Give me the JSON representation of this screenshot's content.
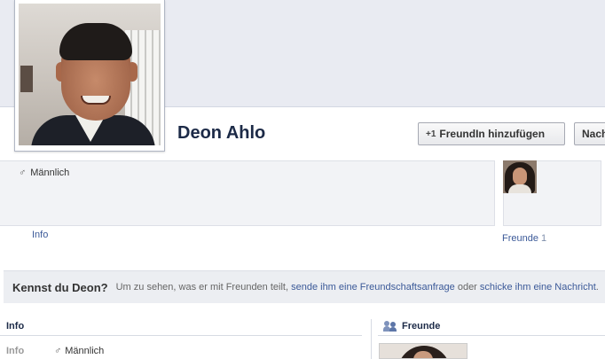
{
  "profile": {
    "name": "Deon Ahlo",
    "gender": "Männlich"
  },
  "actions": {
    "add_friend_icon": "+1",
    "add_friend_label": "FreundIn hinzufügen",
    "message_label": "Nachricht"
  },
  "tabs": {
    "info": "Info",
    "friends": "Freunde",
    "friends_count": "1"
  },
  "know_banner": {
    "title": "Kennst du Deon?",
    "text_before": "Um zu sehen, was er mit Freunden teilt,",
    "link_request": "sende ihm eine Freundschaftsanfrage",
    "text_middle": "oder",
    "link_message": "schicke ihm eine Nachricht",
    "text_after": "."
  },
  "sections": {
    "info_heading": "Info",
    "friends_heading": "Freunde",
    "info_row_label": "Info",
    "info_row_value": "Männlich"
  },
  "icons": {
    "gender": "male-icon",
    "friends": "friends-icon"
  },
  "colors": {
    "link": "#3b5998",
    "name": "#1c2a47",
    "cover": "#e9ebf2"
  }
}
